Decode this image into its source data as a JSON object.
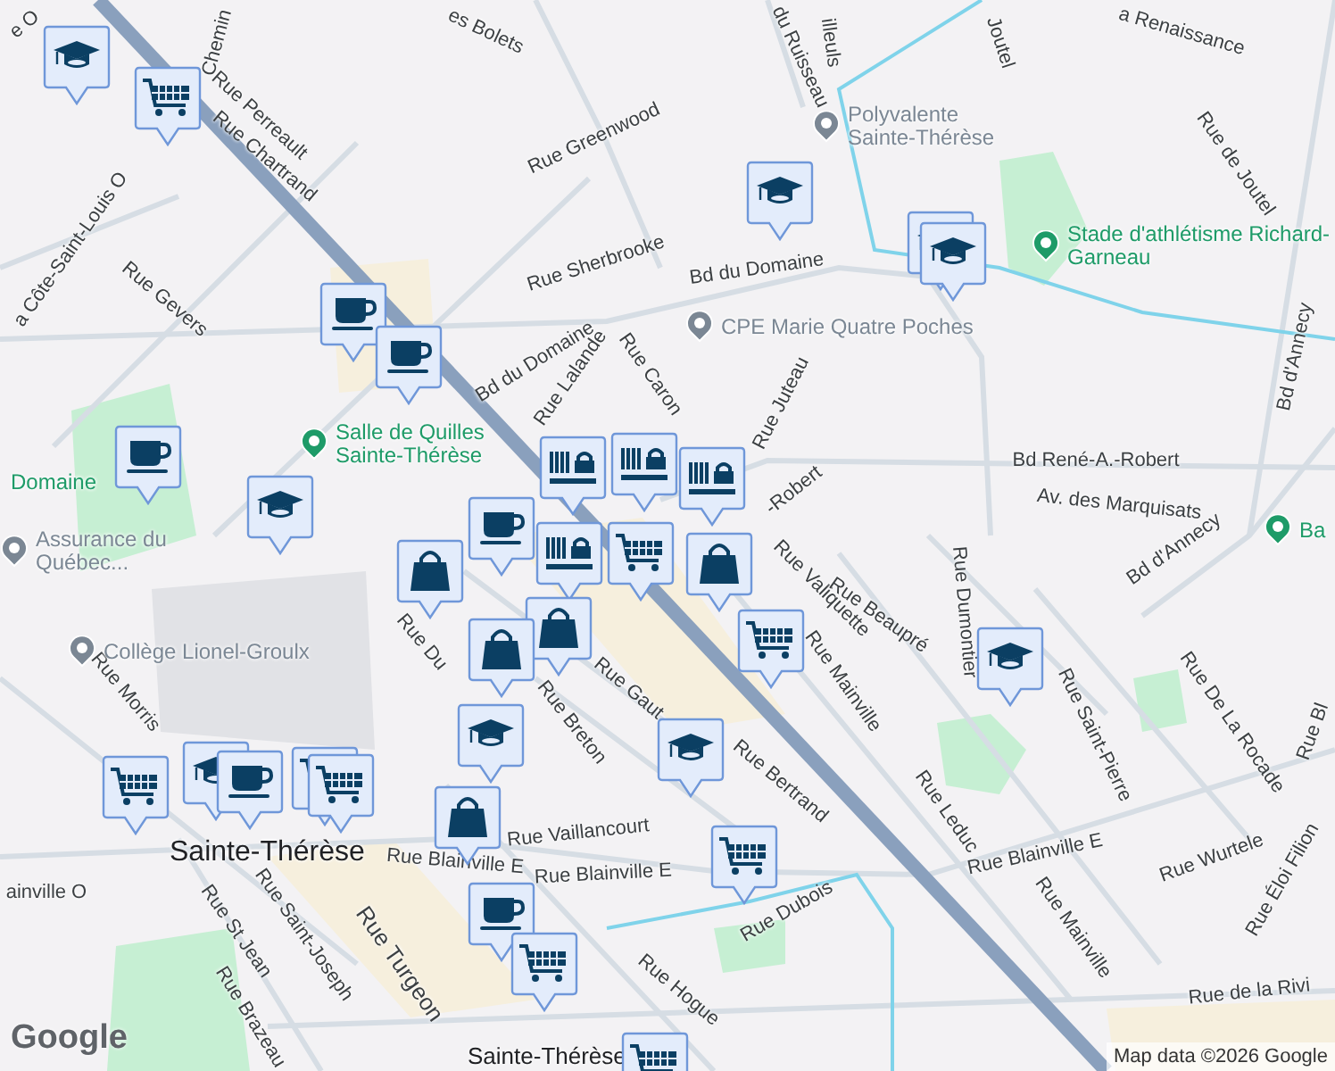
{
  "streets": [
    {
      "text": "Chemin"
    },
    {
      "text": "e O"
    },
    {
      "text": "Rue Perreault"
    },
    {
      "text": "Rue Chartrand"
    },
    {
      "text": "a Côte-Saint-Louis O"
    },
    {
      "text": "Rue Gevers"
    },
    {
      "text": "es Bolets"
    },
    {
      "text": "Rue Greenwood"
    },
    {
      "text": "Rue Sherbrooke"
    },
    {
      "text": "Bd du Domaine"
    },
    {
      "text": "Bd du Domaine"
    },
    {
      "text": "Rue Lalande"
    },
    {
      "text": "Rue Caron"
    },
    {
      "text": "Rue Juteau"
    },
    {
      "text": "du Ruisseau"
    },
    {
      "text": "illeuls"
    },
    {
      "text": "Joutel"
    },
    {
      "text": "a Renaissance"
    },
    {
      "text": "Rue de Joutel"
    },
    {
      "text": "Bd d'Annecy"
    },
    {
      "text": "Bd René-A.-Robert"
    },
    {
      "text": "-Robert"
    },
    {
      "text": "Av. des Marquisats"
    },
    {
      "text": "Bd d'Annecy"
    },
    {
      "text": "Rue Valiquette"
    },
    {
      "text": "Rue Beaupré"
    },
    {
      "text": "Rue Dumontier"
    },
    {
      "text": "Rue Saint-Pierre"
    },
    {
      "text": "Rue De La Rocade"
    },
    {
      "text": "Rue Bl"
    },
    {
      "text": "Rue Wurtele"
    },
    {
      "text": "Rue Éloi Filion"
    },
    {
      "text": "Rue Leduc"
    },
    {
      "text": "Rue Mainville"
    },
    {
      "text": "Rue de la Rivi"
    },
    {
      "text": "Rue Blainville E"
    },
    {
      "text": "Rue Blainville E"
    },
    {
      "text": "Rue Blainville E"
    },
    {
      "text": "ainville O"
    },
    {
      "text": "Rue Bertrand"
    },
    {
      "text": "Rue Dubois"
    },
    {
      "text": "Rue Hogue"
    },
    {
      "text": "Rue Vaillancourt"
    },
    {
      "text": "Rue Breton"
    },
    {
      "text": "Rue Gaut"
    },
    {
      "text": "Rue Du"
    },
    {
      "text": "Rue Morris"
    },
    {
      "text": "Rue St Jean"
    },
    {
      "text": "Rue Saint-Joseph"
    },
    {
      "text": "Rue Brazeau"
    },
    {
      "text": "Rue Turgeon"
    },
    {
      "text": "Rue Mainville"
    }
  ],
  "places": [
    {
      "text": "Stade d'athlétisme Richard-Garneau",
      "kind": "park"
    },
    {
      "text": "Polyvalente Sainte-Thérèse",
      "kind": "school"
    },
    {
      "text": "CPE Marie Quatre Poches",
      "kind": "place"
    },
    {
      "text": "Salle de Quilles Sainte-Thérèse",
      "kind": "park"
    },
    {
      "text": "Domaine",
      "kind": "label"
    },
    {
      "text": "Assurance du Québec...",
      "kind": "place"
    },
    {
      "text": "Collège Lionel-Groulx",
      "kind": "school"
    },
    {
      "text": "Ba",
      "kind": "park"
    }
  ],
  "towns": [
    {
      "text": "Sainte-Thérèse"
    },
    {
      "text": "Sainte-Thérèse"
    }
  ],
  "markers": [
    {
      "kind": "school"
    },
    {
      "kind": "cart"
    },
    {
      "kind": "coffee"
    },
    {
      "kind": "coffee"
    },
    {
      "kind": "school"
    },
    {
      "kind": "coffee"
    },
    {
      "kind": "store"
    },
    {
      "kind": "store"
    },
    {
      "kind": "store"
    },
    {
      "kind": "coffee"
    },
    {
      "kind": "bag"
    },
    {
      "kind": "store"
    },
    {
      "kind": "bag"
    },
    {
      "kind": "cart"
    },
    {
      "kind": "bag"
    },
    {
      "kind": "bag"
    },
    {
      "kind": "school"
    },
    {
      "kind": "school"
    },
    {
      "kind": "school"
    },
    {
      "kind": "school"
    },
    {
      "kind": "cart"
    },
    {
      "kind": "school"
    },
    {
      "kind": "school"
    },
    {
      "kind": "bag"
    },
    {
      "kind": "cart"
    },
    {
      "kind": "cart"
    },
    {
      "kind": "school"
    },
    {
      "kind": "coffee"
    },
    {
      "kind": "cart"
    },
    {
      "kind": "cart"
    },
    {
      "kind": "coffee"
    },
    {
      "kind": "cart"
    },
    {
      "kind": "cart"
    }
  ],
  "logo": "Google",
  "attribution": "Map data ©2026 Google"
}
